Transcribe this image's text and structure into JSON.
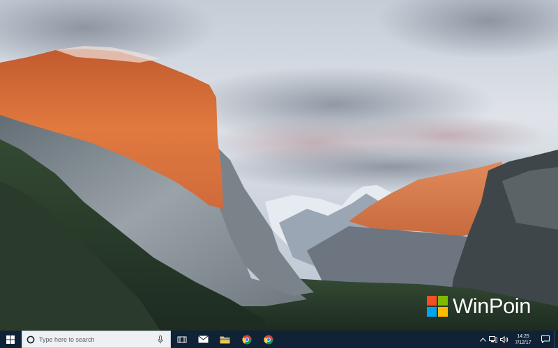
{
  "desktop": {
    "watermark": {
      "text": "WinPoin"
    }
  },
  "taskbar": {
    "start": {
      "icon": "windows-logo-icon"
    },
    "search": {
      "placeholder": "Type here to search",
      "value": "",
      "left_icon": "cortana-circle-icon",
      "right_icon": "microphone-icon"
    },
    "apps": [
      {
        "name": "task-view-icon"
      },
      {
        "name": "mail-icon"
      },
      {
        "name": "file-explorer-icon"
      },
      {
        "name": "chrome-icon"
      },
      {
        "name": "chrome-icon"
      }
    ],
    "tray": {
      "icons": [
        "chevron-up-icon",
        "network-icon",
        "volume-icon"
      ],
      "time": "14:25",
      "date": "7/12/17",
      "notification_icon": "action-center-icon"
    }
  },
  "colors": {
    "taskbar": "#0f2236",
    "search_box": "#eef1f4",
    "start_icon": "#ffffff"
  }
}
